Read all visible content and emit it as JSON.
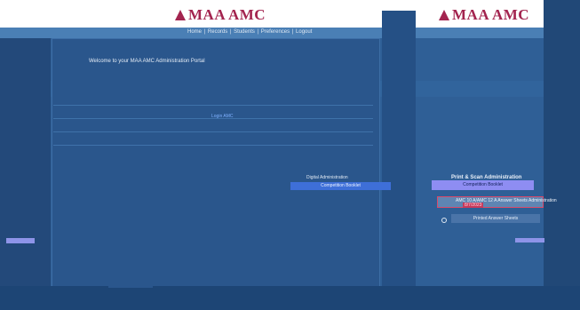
{
  "header": {
    "logo_text": "MAA AMC",
    "logo_text_secondary": "MAA AMC"
  },
  "nav": {
    "items": [
      "Home",
      "Records",
      "Students",
      "Preferences",
      "Logout"
    ]
  },
  "main": {
    "welcome": "Welcome to your MAA AMC Administration Portal",
    "notice_link_1": "Login",
    "notice_link_2": "AMC"
  },
  "digital": {
    "title": "Digital Administration",
    "button_label": "Competition Booklet"
  },
  "print": {
    "title": "Print & Scan Administration",
    "booklet_button": "Competition Booklet",
    "answer_option_label": "AMC 10 A/AMC 12 A Answer Sheets Administration",
    "answer_option_date": "8/7/2023",
    "sheets_button": "Printed Answer Sheets"
  },
  "colors": {
    "background": "#2f5f96",
    "logo": "#a3244f",
    "accent_button": "#8e8df2",
    "link": "#9fd24e"
  }
}
